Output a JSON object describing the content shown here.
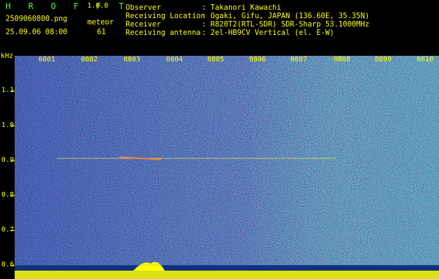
{
  "header": {
    "brand": "H R O F F T",
    "version": "1.0.0",
    "filename": "2509060800.png",
    "meteor_label": "meteor",
    "timestamp": "25.09.06 08:00",
    "meteor_count": "61",
    "observer_label": "Observer",
    "observer_value": ": Takanori Kawachi",
    "location_label": "Receiving Location",
    "location_value": ": Ogaki, Gifu, JAPAN (136.60E, 35.35N)",
    "receiver_label": "Receiver",
    "receiver_value": ": R820T2(RTL-SDR) SDR-Sharp 53.1000MHz",
    "antenna_label": "Receiving antenna",
    "antenna_value": ": 2el-HB9CV Vertical (el. E-W)"
  },
  "axis": {
    "unit": "kHz",
    "y_ticks": [
      "1.1",
      "1.0",
      "0.9",
      "0.8",
      "0.7",
      "0.6"
    ],
    "x_ticks": [
      "0801",
      "0802",
      "0803",
      "0804",
      "0805",
      "0806",
      "0807",
      "0808",
      "0809",
      "0810"
    ]
  },
  "colors": {
    "background": "#000000",
    "spectrum_base": "#0a3a9c",
    "label_yellow": "#ffff00",
    "brand_green": "#40ff40"
  }
}
